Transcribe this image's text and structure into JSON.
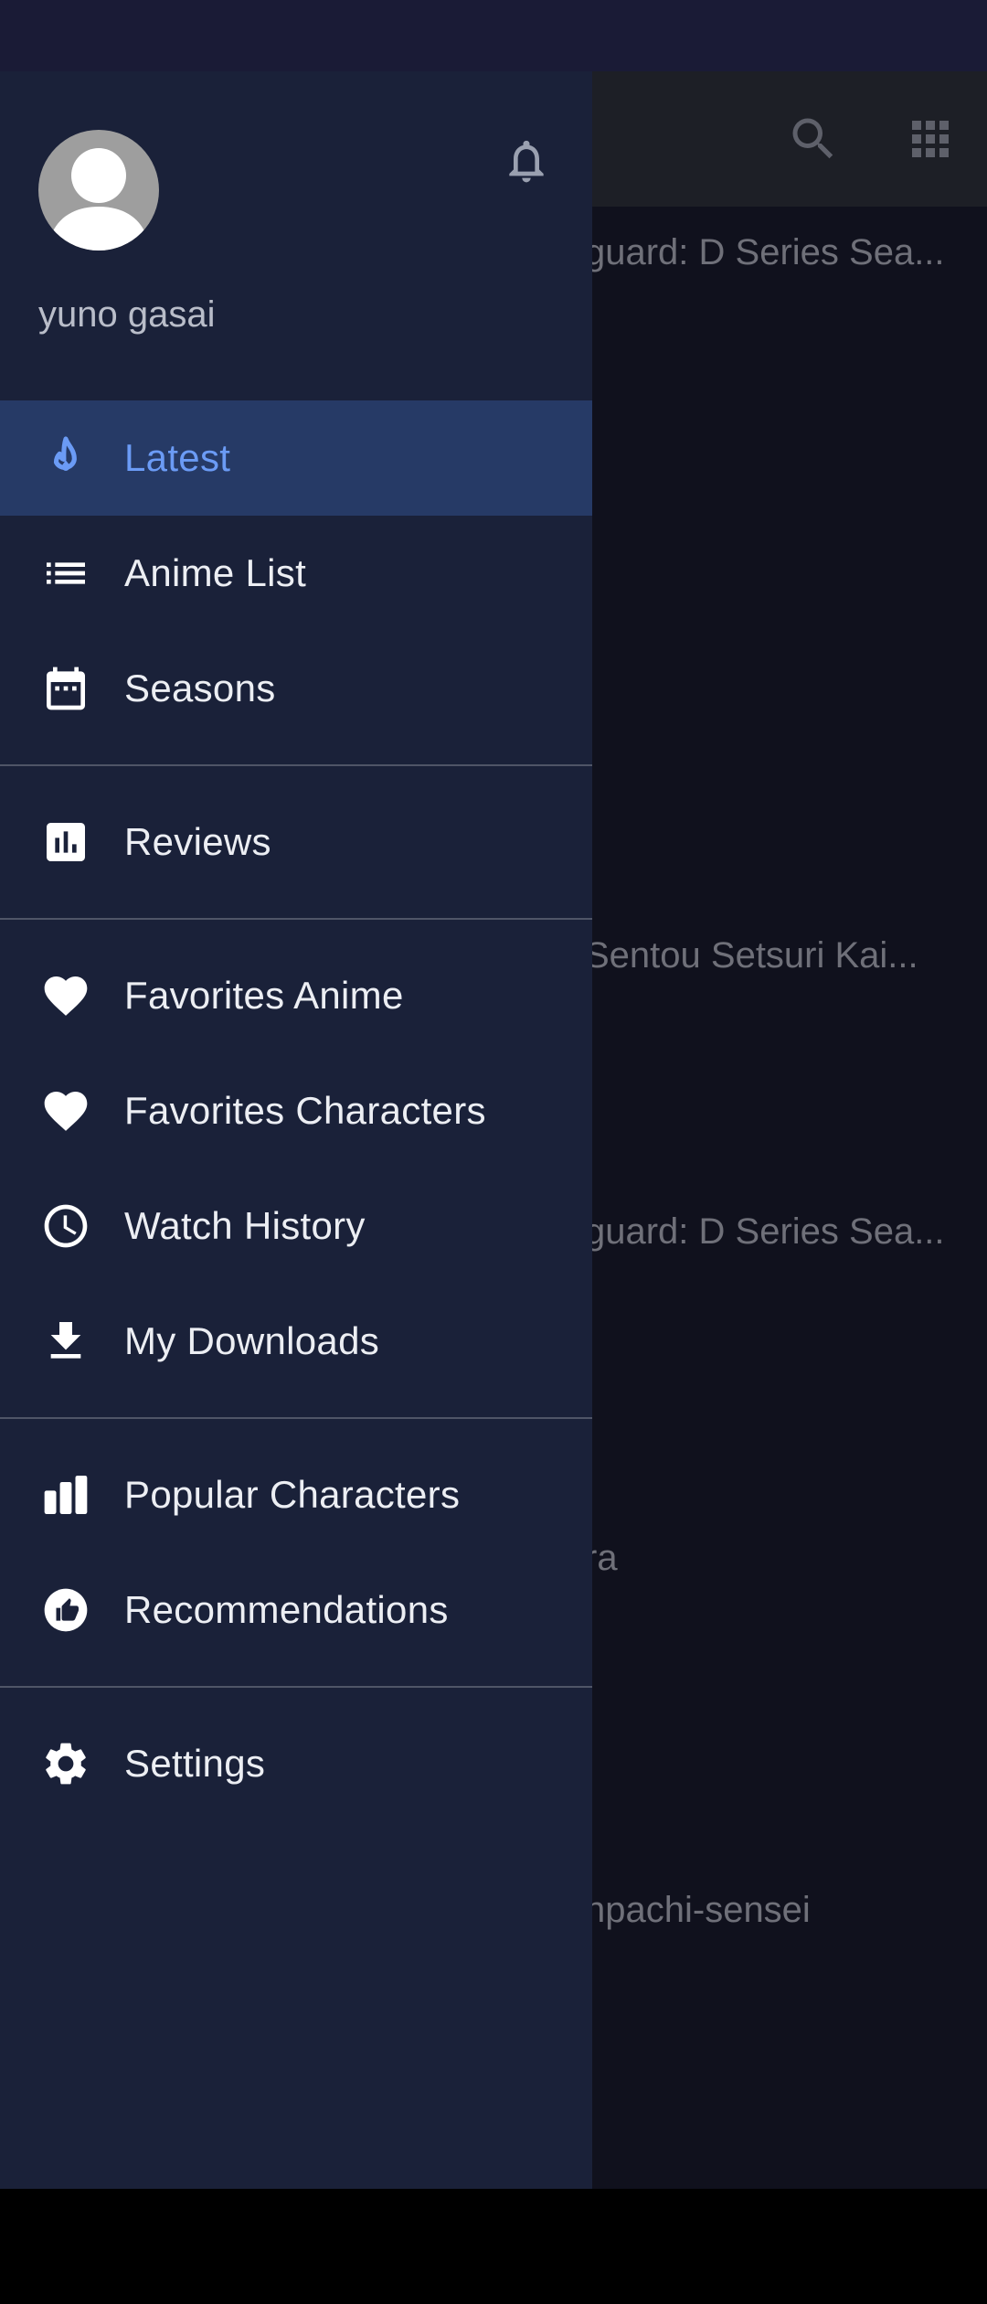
{
  "drawer": {
    "username": "yuno gasai",
    "items": [
      {
        "label": "Latest",
        "icon": "flame-icon"
      },
      {
        "label": "Anime List",
        "icon": "list-icon"
      },
      {
        "label": "Seasons",
        "icon": "calendar-icon"
      },
      {
        "label": "Reviews",
        "icon": "bar-chart-icon"
      },
      {
        "label": "Favorites Anime",
        "icon": "heart-icon"
      },
      {
        "label": "Favorites Characters",
        "icon": "heart-icon"
      },
      {
        "label": "Watch History",
        "icon": "clock-icon"
      },
      {
        "label": "My Downloads",
        "icon": "download-icon"
      },
      {
        "label": "Popular Characters",
        "icon": "podium-icon"
      },
      {
        "label": "Recommendations",
        "icon": "thumb-up-icon"
      },
      {
        "label": "Settings",
        "icon": "gear-icon"
      }
    ]
  },
  "background": {
    "titles": [
      "guard: D Series Sea...",
      "Sentou Setsuri Kai...",
      "guard: D Series Sea...",
      "ra",
      "npachi-sensei"
    ]
  },
  "colors": {
    "drawer_bg": "#1a2139",
    "active_bg": "#263a66",
    "active_text": "#6b9bf5",
    "status_bar": "#1a1b36"
  }
}
